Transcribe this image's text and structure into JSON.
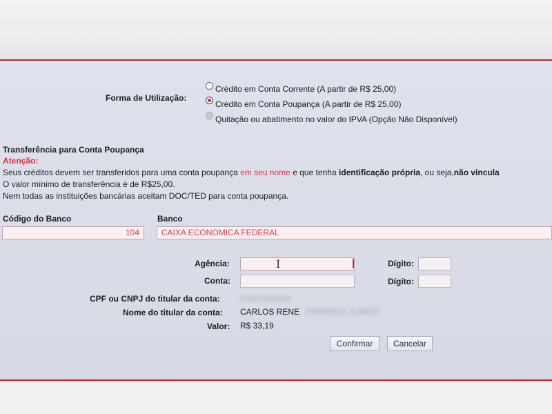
{
  "form": {
    "label": "Forma de Utilização:",
    "options": [
      {
        "label": "Crédito em Conta Corrente (A partir de R$ 25,00)",
        "checked": false,
        "disabled": false
      },
      {
        "label": "Crédito em Conta Poupança (A partir de R$ 25,00)",
        "checked": true,
        "disabled": false
      },
      {
        "label": "Quitação ou abatimento no valor do IPVA (Opção Não Disponível)",
        "checked": false,
        "disabled": true
      }
    ]
  },
  "notice": {
    "title": "Transferência para Conta Poupança",
    "attention": "Atenção:",
    "line1_part1": "Seus créditos devem ser transferidos para uma conta poupança ",
    "line1_highlight": "em seu nome",
    "line1_part2": " e que tenha ",
    "line1_bold1": "identificação própria",
    "line1_part3": ", ou seja,",
    "line1_bold2": "não vincula",
    "line2": "O valor mínimo de transferência é de R$25,00.",
    "line3": "Nem todas as instituições bancárias aceitam DOC/TED para conta poupança."
  },
  "bank": {
    "code_label": "Código do Banco",
    "code_value": "104",
    "name_label": "Banco",
    "name_value": "CAIXA ECONOMICA FEDERAL"
  },
  "account": {
    "agency_label": "Agência:",
    "agency_value": "",
    "agency_digit_label": "Dígito:",
    "account_label": "Conta:",
    "account_value": "",
    "account_digit_label": "Dígito:",
    "cpf_label": "CPF ou CNPJ do titular da conta:",
    "cpf_value": "02401063340",
    "holder_label": "Nome do titular da conta:",
    "holder_visible": "CARLOS RENE",
    "holder_hidden": "PINHEIRO JUNIOR",
    "value_label": "Valor:",
    "value_value": "R$ 33,19"
  },
  "buttons": {
    "confirm": "Confirmar",
    "cancel": "Cancelar"
  },
  "colors": {
    "accent_red": "#e0323b",
    "panel_bg": "#dadde8"
  }
}
